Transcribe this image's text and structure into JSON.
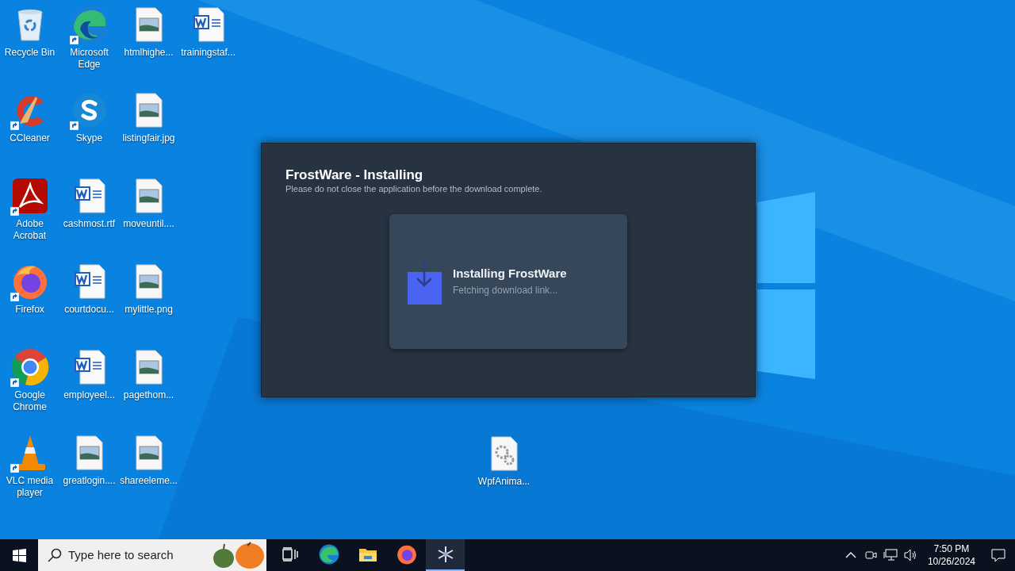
{
  "desktop": {
    "columns": [
      [
        {
          "label": "Recycle Bin",
          "kind": "recycle",
          "shortcut": false
        },
        {
          "label": "CCleaner",
          "kind": "ccleaner",
          "shortcut": true
        },
        {
          "label": "Adobe Acrobat",
          "kind": "pdf",
          "shortcut": true
        },
        {
          "label": "Firefox",
          "kind": "firefox",
          "shortcut": true
        },
        {
          "label": "Google Chrome",
          "kind": "chrome",
          "shortcut": true
        },
        {
          "label": "VLC media player",
          "kind": "vlc",
          "shortcut": true
        }
      ],
      [
        {
          "label": "Microsoft Edge",
          "kind": "edge",
          "shortcut": true
        },
        {
          "label": "Skype",
          "kind": "skype",
          "shortcut": true
        },
        {
          "label": "cashmost.rtf",
          "kind": "word",
          "shortcut": false
        },
        {
          "label": "courtdocu...",
          "kind": "word",
          "shortcut": false
        },
        {
          "label": "employeel...",
          "kind": "word",
          "shortcut": false
        },
        {
          "label": "greatlogin....",
          "kind": "image",
          "shortcut": false
        }
      ],
      [
        {
          "label": "htmlhighe...",
          "kind": "image",
          "shortcut": false
        },
        {
          "label": "listingfair.jpg",
          "kind": "image",
          "shortcut": false
        },
        {
          "label": "moveuntil....",
          "kind": "image",
          "shortcut": false
        },
        {
          "label": "mylittle.png",
          "kind": "image",
          "shortcut": false
        },
        {
          "label": "pagethom...",
          "kind": "image",
          "shortcut": false
        },
        {
          "label": "shareeleme...",
          "kind": "image",
          "shortcut": false
        }
      ],
      [
        {
          "label": "trainingstaf...",
          "kind": "word",
          "shortcut": false
        }
      ]
    ],
    "loose_icons": [
      {
        "label": "WpfAnima...",
        "kind": "gearfile",
        "shortcut": false
      }
    ]
  },
  "dialog": {
    "title": "FrostWare - Installing",
    "subtitle": "Please do not close the application before the download complete.",
    "card": {
      "heading": "Installing FrostWare",
      "status": "Fetching download link..."
    }
  },
  "taskbar": {
    "search": {
      "placeholder": "Type here to search"
    },
    "apps": [
      {
        "kind": "taskview",
        "selected": false
      },
      {
        "kind": "edge",
        "selected": false
      },
      {
        "kind": "explorer",
        "selected": false
      },
      {
        "kind": "firefox",
        "selected": false
      },
      {
        "kind": "frost",
        "selected": true
      }
    ],
    "tray": {
      "time": "7:50 PM",
      "date": "10/26/2024"
    }
  }
}
